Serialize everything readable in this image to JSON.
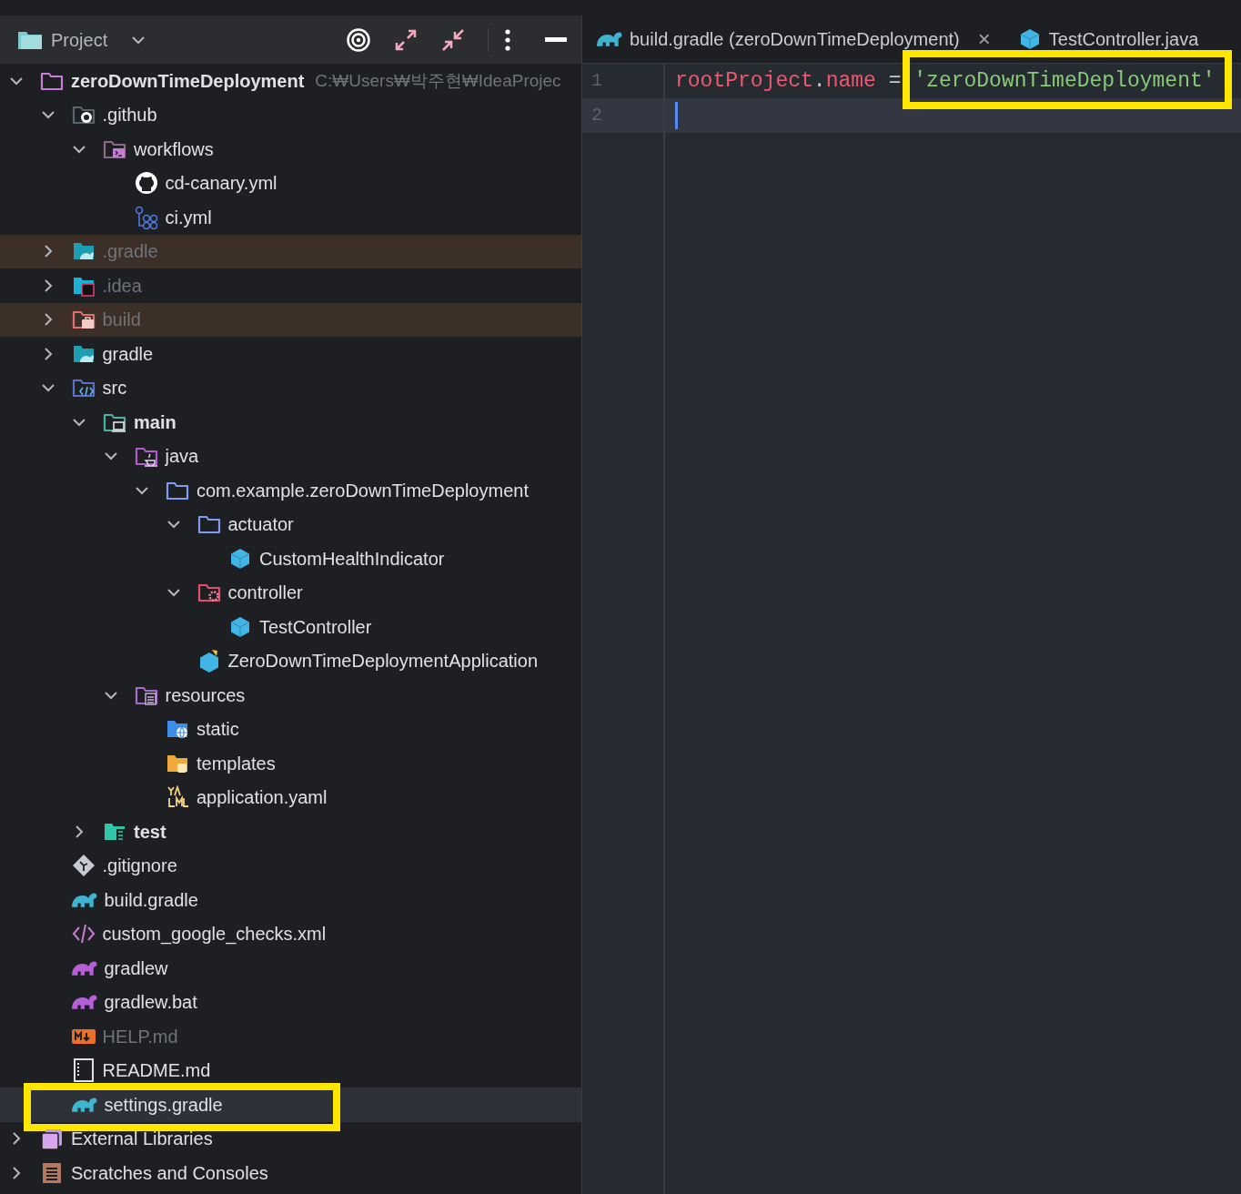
{
  "project_panel": {
    "title": "Project",
    "tree": [
      {
        "label": "zeroDownTimeDeployment",
        "hint": "C:₩Users₩박주현₩IdeaProjec",
        "kind": "folder",
        "bold": true,
        "expanded": true,
        "children": [
          {
            "label": ".github",
            "kind": "github-folder",
            "expanded": true,
            "children": [
              {
                "label": "workflows",
                "kind": "workflows-folder",
                "expanded": true,
                "children": [
                  {
                    "label": "cd-canary.yml",
                    "kind": "github-file"
                  },
                  {
                    "label": "ci.yml",
                    "kind": "workflow-file"
                  }
                ]
              }
            ]
          },
          {
            "label": ".gradle",
            "kind": "gradle-folder",
            "expanded": false,
            "dimmed": true,
            "excluded": true
          },
          {
            "label": ".idea",
            "kind": "idea-folder",
            "expanded": false,
            "dimmed": true
          },
          {
            "label": "build",
            "kind": "build-folder",
            "expanded": false,
            "dimmed": true,
            "excluded": true
          },
          {
            "label": "gradle",
            "kind": "gradle-folder",
            "expanded": false
          },
          {
            "label": "src",
            "kind": "src-folder",
            "expanded": true,
            "children": [
              {
                "label": "main",
                "kind": "main-folder",
                "bold": true,
                "expanded": true,
                "children": [
                  {
                    "label": "java",
                    "kind": "java-folder",
                    "expanded": true,
                    "children": [
                      {
                        "label": "com.example.zeroDownTimeDeployment",
                        "kind": "package",
                        "expanded": true,
                        "children": [
                          {
                            "label": "actuator",
                            "kind": "package",
                            "expanded": true,
                            "children": [
                              {
                                "label": "CustomHealthIndicator",
                                "kind": "class"
                              }
                            ]
                          },
                          {
                            "label": "controller",
                            "kind": "controller-folder",
                            "expanded": true,
                            "children": [
                              {
                                "label": "TestController",
                                "kind": "class"
                              }
                            ]
                          },
                          {
                            "label": "ZeroDownTimeDeploymentApplication",
                            "kind": "spring-class"
                          }
                        ]
                      }
                    ]
                  },
                  {
                    "label": "resources",
                    "kind": "resources-folder",
                    "expanded": true,
                    "children": [
                      {
                        "label": "static",
                        "kind": "static-folder"
                      },
                      {
                        "label": "templates",
                        "kind": "templates-folder"
                      },
                      {
                        "label": "application.yaml",
                        "kind": "yaml"
                      }
                    ]
                  }
                ]
              },
              {
                "label": "test",
                "kind": "test-folder",
                "bold": true,
                "expanded": false
              }
            ]
          },
          {
            "label": ".gitignore",
            "kind": "gitignore"
          },
          {
            "label": "build.gradle",
            "kind": "gradle-file"
          },
          {
            "label": "custom_google_checks.xml",
            "kind": "xml"
          },
          {
            "label": "gradlew",
            "kind": "gradlew"
          },
          {
            "label": "gradlew.bat",
            "kind": "gradlew"
          },
          {
            "label": "HELP.md",
            "kind": "markdown",
            "dimmed": true
          },
          {
            "label": "README.md",
            "kind": "readme"
          },
          {
            "label": "settings.gradle",
            "kind": "gradle-file",
            "selected": true,
            "highlighted": true
          }
        ]
      },
      {
        "label": "External Libraries",
        "kind": "libraries",
        "expanded": false
      },
      {
        "label": "Scratches and Consoles",
        "kind": "scratches",
        "expanded": false
      }
    ]
  },
  "editor": {
    "tabs": [
      {
        "label": "build.gradle (zeroDownTimeDeployment)",
        "kind": "gradle-file",
        "close": "×"
      },
      {
        "label": "TestController.java",
        "kind": "class"
      }
    ],
    "lines": [
      {
        "number": "1",
        "current": false,
        "tokens": [
          {
            "text": "rootProject",
            "kind": "ident"
          },
          {
            "text": ".",
            "kind": "punct"
          },
          {
            "text": "name",
            "kind": "ident"
          },
          {
            "text": " = ",
            "kind": "punct"
          },
          {
            "text": "'zeroDownTimeDeployment'",
            "kind": "string",
            "highlighted": true
          }
        ]
      },
      {
        "number": "2",
        "current": true,
        "caret": true
      }
    ]
  }
}
